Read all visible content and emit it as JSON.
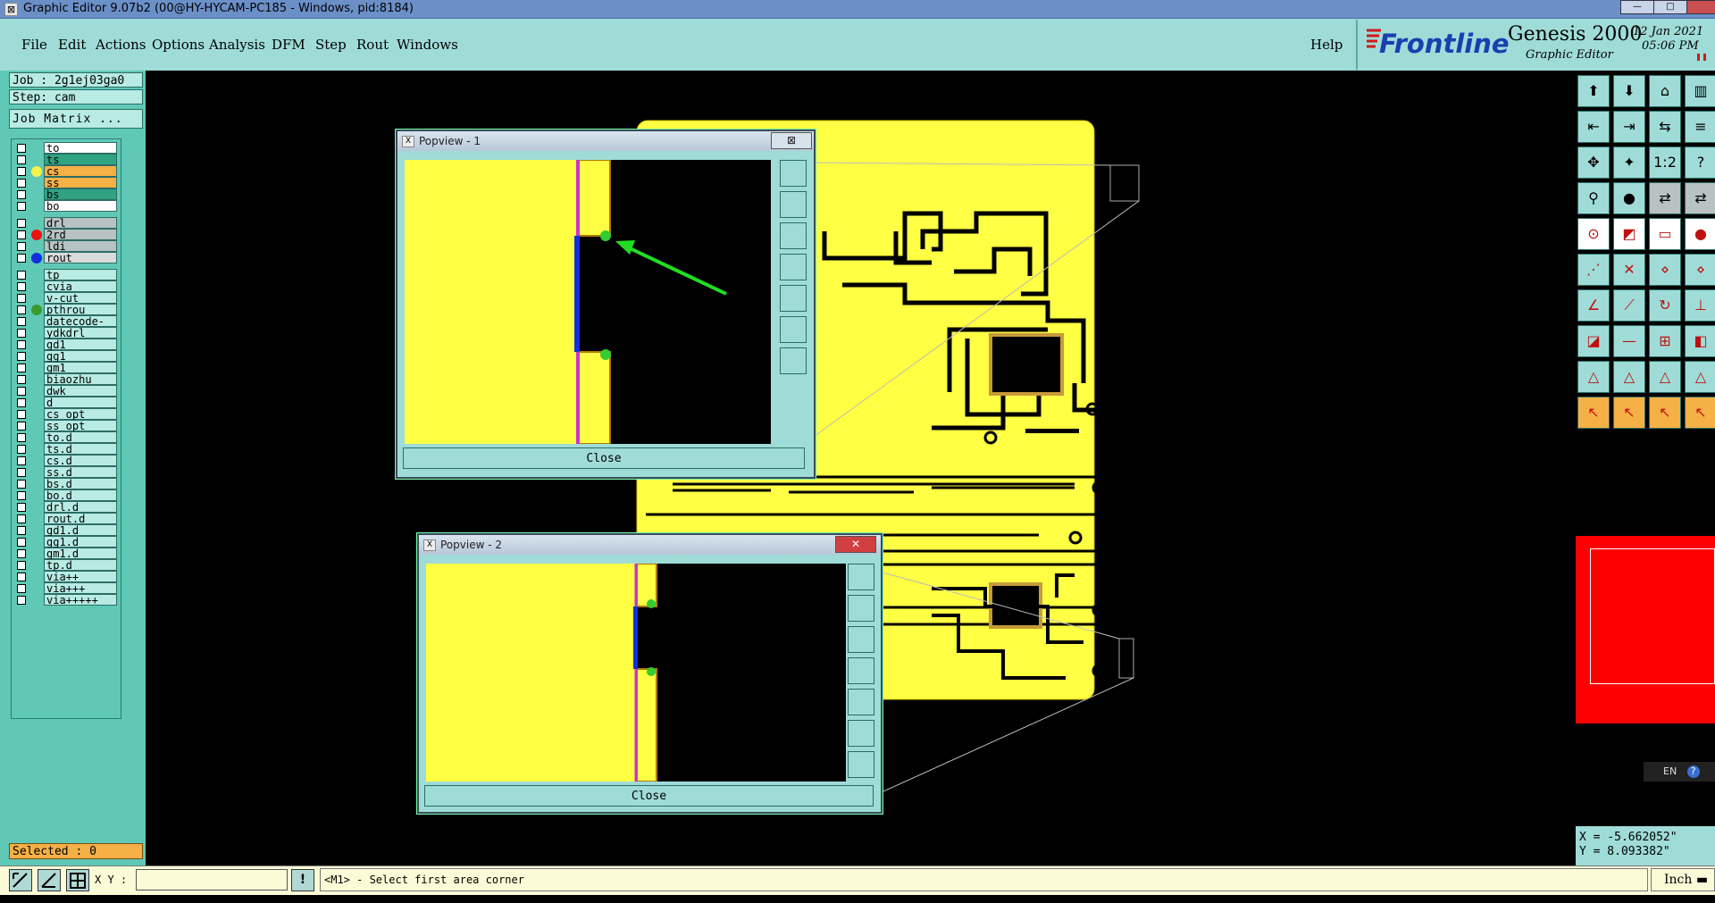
{
  "window": {
    "title": "Graphic Editor 9.07b2 (00@HY-HYCAM-PC185 - Windows, pid:8184)",
    "controls": [
      "—",
      "□"
    ]
  },
  "menubar": {
    "items": [
      "File",
      "Edit",
      "Actions",
      "Options",
      "Analysis",
      "DFM",
      "Step",
      "Rout",
      "Windows"
    ],
    "help": "Help"
  },
  "brand": {
    "logo_text": "Frontline",
    "product": "Genesis 2000",
    "subtitle": "Graphic Editor",
    "date": "12 Jan 2021",
    "time": "05:06 PM"
  },
  "job_info": {
    "job": "Job : 2g1ej03ga0",
    "step": "Step: cam",
    "matrix_button": "Job Matrix ..."
  },
  "layers": [
    {
      "name": "to",
      "bg": "#ffffff",
      "dot": ""
    },
    {
      "name": "ts",
      "bg": "#2fa382",
      "dot": ""
    },
    {
      "name": "cs",
      "bg": "#f5b046",
      "dot": "#f3f34a"
    },
    {
      "name": "ss",
      "bg": "#f5b046",
      "dot": ""
    },
    {
      "name": "bs",
      "bg": "#2fa382",
      "dot": ""
    },
    {
      "name": "bo",
      "bg": "#ffffff",
      "dot": ""
    },
    {
      "name": "drl",
      "bg": "#b8c2c2",
      "dot": ""
    },
    {
      "name": "2rd",
      "bg": "#b8c2c2",
      "dot": "#ee1111"
    },
    {
      "name": "ldi",
      "bg": "#b8c2c2",
      "dot": ""
    },
    {
      "name": "rout",
      "bg": "#d9dada",
      "dot": "#1030e0"
    },
    {
      "name": "tp",
      "bg": "#b7ebe3",
      "dot": ""
    },
    {
      "name": "cvia",
      "bg": "#b7ebe3",
      "dot": ""
    },
    {
      "name": "v-cut",
      "bg": "#b7ebe3",
      "dot": ""
    },
    {
      "name": "pthrou",
      "bg": "#b7ebe3",
      "dot": "#3a9a2a"
    },
    {
      "name": "datecode-to",
      "bg": "#b7ebe3",
      "dot": ""
    },
    {
      "name": "ydkdrl",
      "bg": "#b7ebe3",
      "dot": ""
    },
    {
      "name": "gd1",
      "bg": "#b7ebe3",
      "dot": ""
    },
    {
      "name": "gg1",
      "bg": "#b7ebe3",
      "dot": ""
    },
    {
      "name": "gm1",
      "bg": "#b7ebe3",
      "dot": ""
    },
    {
      "name": "biaozhu",
      "bg": "#b7ebe3",
      "dot": ""
    },
    {
      "name": "dwk",
      "bg": "#b7ebe3",
      "dot": ""
    },
    {
      "name": "d",
      "bg": "#b7ebe3",
      "dot": ""
    },
    {
      "name": "cs_opt",
      "bg": "#b7ebe3",
      "dot": ""
    },
    {
      "name": "ss_opt",
      "bg": "#b7ebe3",
      "dot": ""
    },
    {
      "name": "to.d",
      "bg": "#b7ebe3",
      "dot": ""
    },
    {
      "name": "ts.d",
      "bg": "#b7ebe3",
      "dot": ""
    },
    {
      "name": "cs.d",
      "bg": "#b7ebe3",
      "dot": ""
    },
    {
      "name": "ss.d",
      "bg": "#b7ebe3",
      "dot": ""
    },
    {
      "name": "bs.d",
      "bg": "#b7ebe3",
      "dot": ""
    },
    {
      "name": "bo.d",
      "bg": "#b7ebe3",
      "dot": ""
    },
    {
      "name": "drl.d",
      "bg": "#b7ebe3",
      "dot": ""
    },
    {
      "name": "rout.d",
      "bg": "#b7ebe3",
      "dot": ""
    },
    {
      "name": "gd1.d",
      "bg": "#b7ebe3",
      "dot": ""
    },
    {
      "name": "gg1.d",
      "bg": "#b7ebe3",
      "dot": ""
    },
    {
      "name": "gm1.d",
      "bg": "#b7ebe3",
      "dot": ""
    },
    {
      "name": "tp.d",
      "bg": "#b7ebe3",
      "dot": ""
    },
    {
      "name": "via++",
      "bg": "#b7ebe3",
      "dot": ""
    },
    {
      "name": "via+++",
      "bg": "#b7ebe3",
      "dot": ""
    },
    {
      "name": "via+++++",
      "bg": "#b7ebe3",
      "dot": ""
    }
  ],
  "selected": "Selected : 0",
  "popview1": {
    "title": "Popview - 1",
    "close_label": "Close",
    "x_label": "X"
  },
  "popview2": {
    "title": "Popview - 2",
    "close_label": "Close",
    "x_label": "X"
  },
  "statusbar": {
    "xy_label": "X Y :",
    "xy_value": "",
    "message": "<M1> - Select first area corner",
    "unit": "Inch"
  },
  "coords": {
    "x": "X = -5.662052\"",
    "y": "Y = 8.093382\""
  },
  "ime": {
    "lang": "EN"
  },
  "colors": {
    "board": "#ffff44",
    "panel": "#9fdcd8",
    "accent_orange": "#f5b046",
    "rout": "#1030e0"
  }
}
